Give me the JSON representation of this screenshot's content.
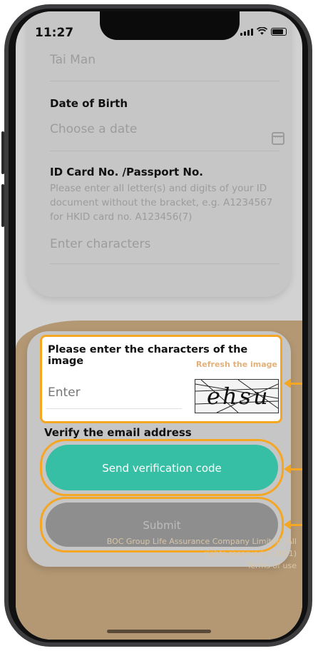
{
  "status_bar": {
    "time": "11:27"
  },
  "form": {
    "name_value": "Tai Man",
    "dob_label": "Date of Birth",
    "dob_placeholder": "Choose a date",
    "id_label": "ID Card No. /Passport No.",
    "id_hint": "Please enter all letter(s) and digits of your ID document without the bracket, e.g. A1234567 for HKID card no. A123456(7)",
    "id_placeholder": "Enter characters"
  },
  "captcha": {
    "title": "Please enter the characters of the image",
    "refresh_label": "Refresh the image",
    "input_placeholder": "Enter",
    "image_text": "ehsu"
  },
  "email": {
    "label": "Verify the email address",
    "send_button": "Send verification code"
  },
  "submit_button": "Submit",
  "footer": {
    "copyright": "BOC Group Life Assurance Company Limited (All rights reserved ©2021)",
    "terms": "Terms of use"
  },
  "icons": {
    "calendar": "calendar-icon",
    "signal": "signal-icon",
    "wifi": "wifi-icon",
    "battery": "battery-icon"
  },
  "colors": {
    "accent_teal": "#36bfa5",
    "highlight_orange": "#f5a623",
    "refresh_link": "#e2b079",
    "background_brown": "#b49874"
  }
}
